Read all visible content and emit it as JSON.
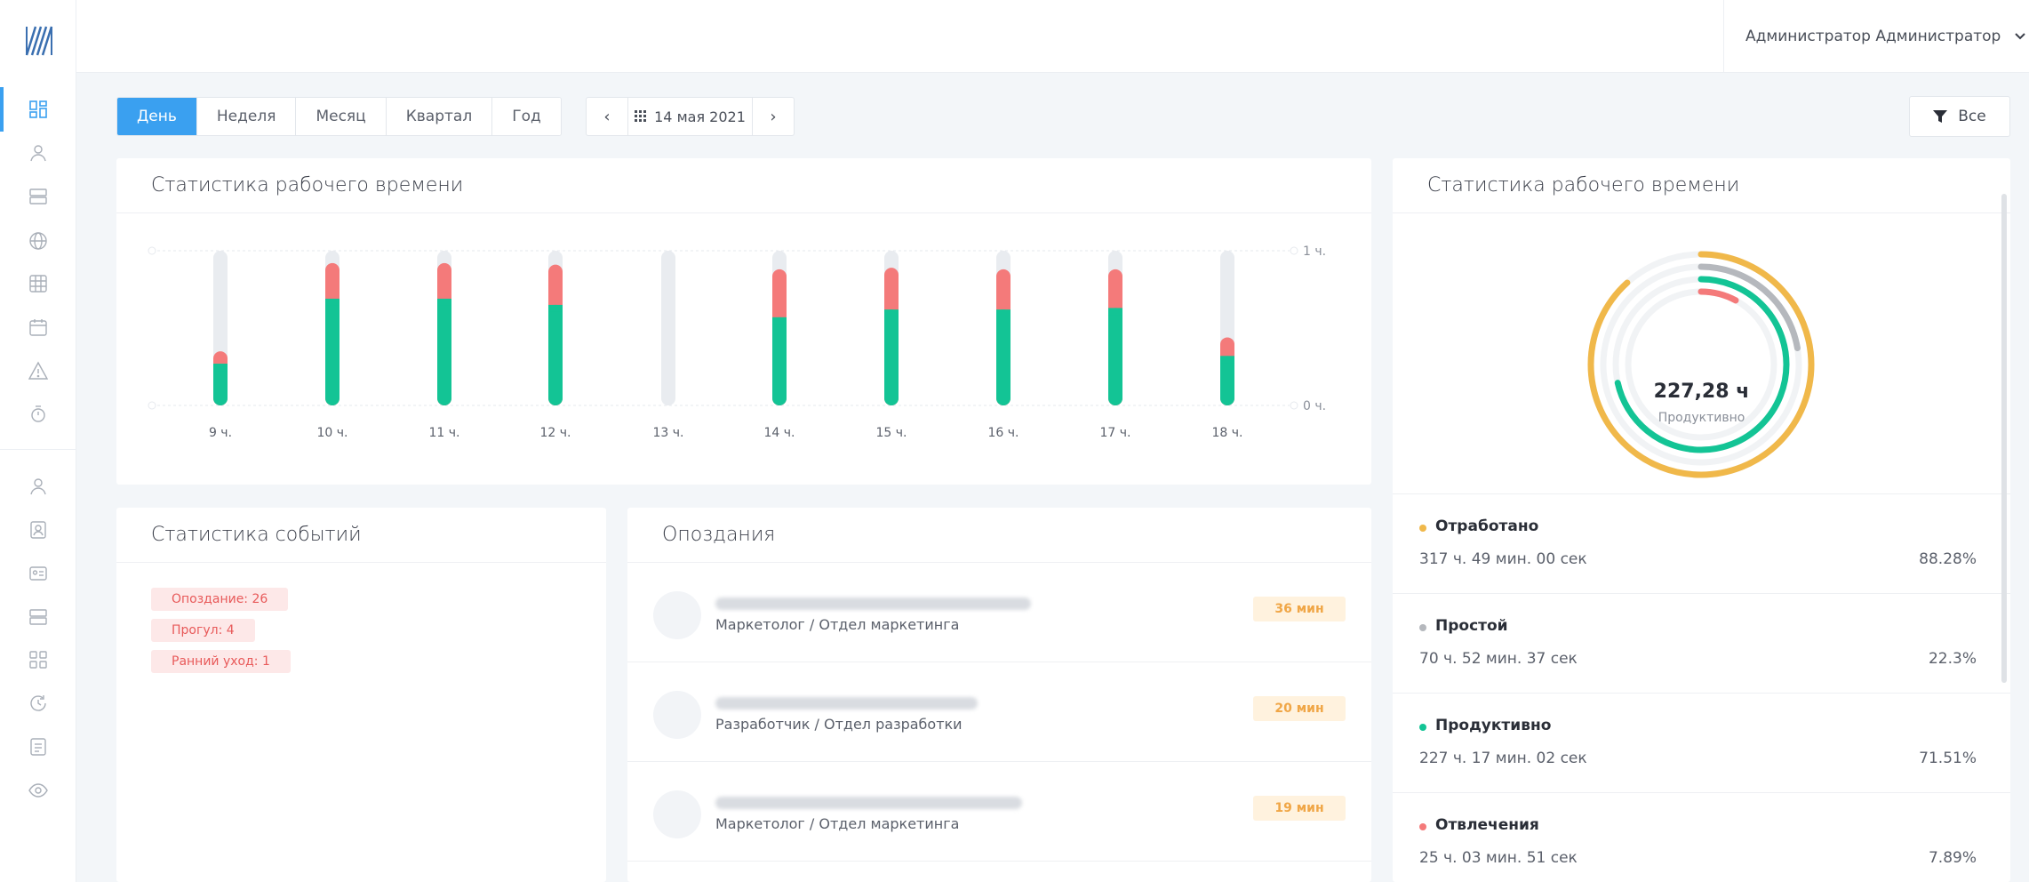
{
  "header": {
    "user_name": "Администратор Администратор"
  },
  "periods": {
    "tabs": [
      "День",
      "Неделя",
      "Месяц",
      "Квартал",
      "Год"
    ],
    "active": "День",
    "date": "14 мая 2021"
  },
  "filter": {
    "label": "Все"
  },
  "hours_card": {
    "title": "Статистика рабочего времени"
  },
  "chart_data": {
    "type": "bar",
    "stacked": true,
    "categories": [
      "9 ч.",
      "10 ч.",
      "11 ч.",
      "12 ч.",
      "13 ч.",
      "14 ч.",
      "15 ч.",
      "16 ч.",
      "17 ч.",
      "18 ч."
    ],
    "series": [
      {
        "values": [
          0.27,
          0.69,
          0.69,
          0.65,
          0.0,
          0.57,
          0.62,
          0.62,
          0.63,
          0.32
        ],
        "color": "#13c495"
      },
      {
        "values": [
          0.08,
          0.23,
          0.23,
          0.26,
          0.0,
          0.31,
          0.27,
          0.26,
          0.25,
          0.12
        ],
        "color": "#f47a7a"
      }
    ],
    "ylim": [
      0,
      1
    ],
    "right_axis_ticks": [
      "0 ч.",
      "1 ч."
    ],
    "track_color": "#e9ecf0"
  },
  "events_card": {
    "title": "Статистика событий",
    "badges": [
      "Опоздание: 26",
      "Прогул: 4",
      "Ранний уход: 1"
    ]
  },
  "late_card": {
    "title": "Опоздания",
    "rows": [
      {
        "role": "Маркетолог / Отдел маркетинга",
        "time": "36 мин"
      },
      {
        "role": "Разработчик / Отдел разработки",
        "time": "20 мин"
      },
      {
        "role": "Маркетолог / Отдел маркетинга",
        "time": "19 мин"
      }
    ]
  },
  "donut_card": {
    "title": "Статистика рабочего времени",
    "center_value": "227,28 ч",
    "center_label": "Продуктивно",
    "stats": [
      {
        "name": "Отработано",
        "time": "317 ч. 49 мин. 00 сек",
        "pct": "88.28%",
        "color": "#f0b84a"
      },
      {
        "name": "Простой",
        "time": "70 ч. 52 мин. 37 сек",
        "pct": "22.3%",
        "color": "#b5b8bd"
      },
      {
        "name": "Продуктивно",
        "time": "227 ч. 17 мин. 02 сек",
        "pct": "71.51%",
        "color": "#13c495"
      },
      {
        "name": "Отвлечения",
        "time": "25 ч. 03 мин. 51 сек",
        "pct": "7.89%",
        "color": "#f47a7a"
      }
    ]
  }
}
